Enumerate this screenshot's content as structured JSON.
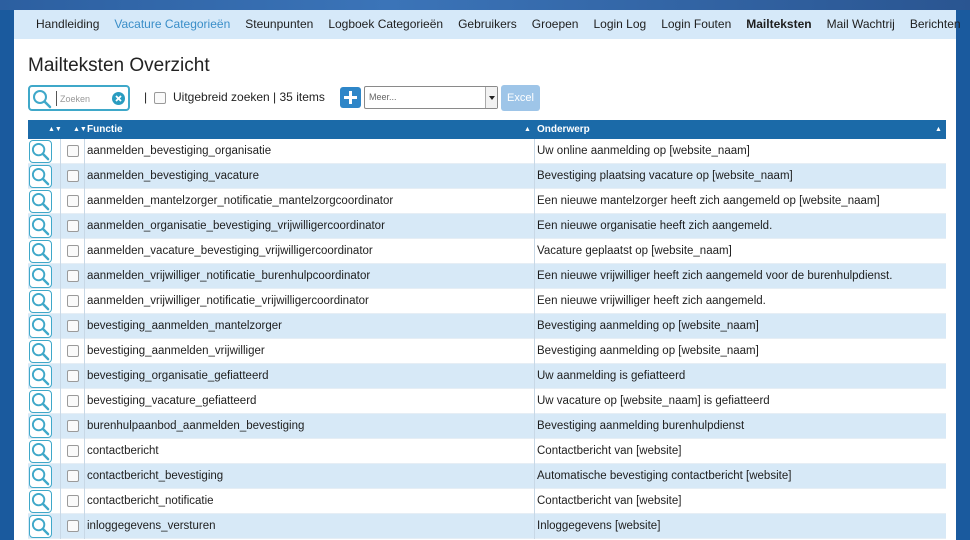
{
  "nav": {
    "items": [
      {
        "label": "Handleiding",
        "state": "normal"
      },
      {
        "label": "Vacature Categorieën",
        "state": "link"
      },
      {
        "label": "Steunpunten",
        "state": "normal"
      },
      {
        "label": "Logboek Categorieën",
        "state": "normal"
      },
      {
        "label": "Gebruikers",
        "state": "normal"
      },
      {
        "label": "Groepen",
        "state": "normal"
      },
      {
        "label": "Login Log",
        "state": "normal"
      },
      {
        "label": "Login Fouten",
        "state": "normal"
      },
      {
        "label": "Mailteksten",
        "state": "active"
      },
      {
        "label": "Mail Wachtrij",
        "state": "normal"
      },
      {
        "label": "Berichten",
        "state": "normal"
      }
    ]
  },
  "page": {
    "title": "Mailteksten Overzicht"
  },
  "toolbar": {
    "search_placeholder": "Zoeken",
    "separator": "|",
    "advanced_label": "Uitgebreid zoeken | 35 items",
    "more_select_value": "Meer...",
    "excel_label": "Excel"
  },
  "grid": {
    "columns": {
      "sel_sort": "",
      "functie": "Functie",
      "onderwerp": "Onderwerp"
    },
    "rows": [
      {
        "functie": "aanmelden_bevestiging_organisatie",
        "onderwerp": "Uw online aanmelding op [website_naam]"
      },
      {
        "functie": "aanmelden_bevestiging_vacature",
        "onderwerp": "Bevestiging plaatsing vacature op [website_naam]"
      },
      {
        "functie": "aanmelden_mantelzorger_notificatie_mantelzorgcoordinator",
        "onderwerp": "Een nieuwe mantelzorger heeft zich aangemeld op [website_naam]"
      },
      {
        "functie": "aanmelden_organisatie_bevestiging_vrijwilligercoordinator",
        "onderwerp": "Een nieuwe organisatie heeft zich aangemeld."
      },
      {
        "functie": "aanmelden_vacature_bevestiging_vrijwilligercoordinator",
        "onderwerp": "Vacature geplaatst op [website_naam]"
      },
      {
        "functie": "aanmelden_vrijwilliger_notificatie_burenhulpcoordinator",
        "onderwerp": "Een nieuwe vrijwilliger heeft zich aangemeld voor de burenhulpdienst."
      },
      {
        "functie": "aanmelden_vrijwilliger_notificatie_vrijwilligercoordinator",
        "onderwerp": "Een nieuwe vrijwilliger heeft zich aangemeld."
      },
      {
        "functie": "bevestiging_aanmelden_mantelzorger",
        "onderwerp": "Bevestiging aanmelding op [website_naam]"
      },
      {
        "functie": "bevestiging_aanmelden_vrijwilliger",
        "onderwerp": "Bevestiging aanmelding op [website_naam]"
      },
      {
        "functie": "bevestiging_organisatie_gefiatteerd",
        "onderwerp": "Uw aanmelding is gefiatteerd"
      },
      {
        "functie": "bevestiging_vacature_gefiatteerd",
        "onderwerp": "Uw vacature op [website_naam] is gefiatteerd"
      },
      {
        "functie": "burenhulpaanbod_aanmelden_bevestiging",
        "onderwerp": "Bevestiging aanmelding burenhulpdienst"
      },
      {
        "functie": "contactbericht",
        "onderwerp": "Contactbericht van [website]"
      },
      {
        "functie": "contactbericht_bevestiging",
        "onderwerp": "Automatische bevestiging contactbericht [website]"
      },
      {
        "functie": "contactbericht_notificatie",
        "onderwerp": "Contactbericht van [website]"
      },
      {
        "functie": "inloggegevens_versturen",
        "onderwerp": "Inloggegevens [website]"
      }
    ]
  },
  "colors": {
    "nav_bg": "#d6e9f9",
    "header_bg": "#1b6aa8",
    "row_alt": "#d7e9f7",
    "accent": "#3fa8c9",
    "add_button": "#2e86c8",
    "excel_button": "#9ec5e8"
  }
}
